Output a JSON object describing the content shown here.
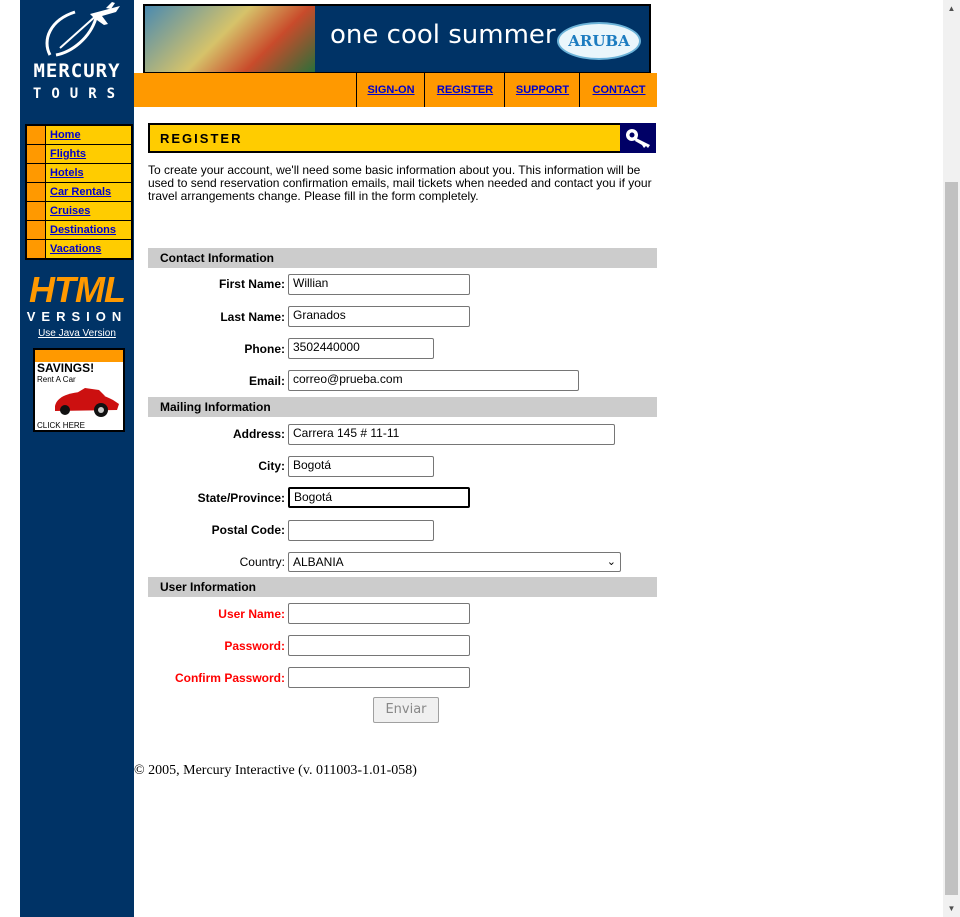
{
  "logo": {
    "line1": "MERCURY",
    "line2": "TOURS"
  },
  "left_nav": {
    "items": [
      "Home",
      "Flights",
      "Hotels",
      "Car Rentals",
      "Cruises",
      "Destinations",
      "Vacations"
    ]
  },
  "html_version": {
    "badge": "HTML",
    "label": "VERSION",
    "java_link": "Use Java Version"
  },
  "ad": {
    "title": "SAVINGS!",
    "subtitle": "Rent A Car",
    "cta": "CLICK HERE"
  },
  "banner": {
    "text": "one cool summer",
    "logo": "ARUBA"
  },
  "top_nav": {
    "items": [
      "SIGN-ON",
      "REGISTER",
      "SUPPORT",
      "CONTACT"
    ]
  },
  "page": {
    "title": "REGISTER",
    "intro": "To create your account, we'll need some basic information about you. This information will be used to send reservation confirmation emails, mail tickets when needed and contact you if your travel arrangements change. Please fill in the form completely."
  },
  "sections": {
    "contact": {
      "header": "Contact Information",
      "first_name": {
        "label": "First Name:",
        "value": "Willian"
      },
      "last_name": {
        "label": "Last Name:",
        "value": "Granados"
      },
      "phone": {
        "label": "Phone:",
        "value": "3502440000"
      },
      "email": {
        "label": "Email:",
        "value": "correo@prueba.com"
      }
    },
    "mailing": {
      "header": "Mailing Information",
      "address": {
        "label": "Address:",
        "value": "Carrera 145 # 11-11"
      },
      "city": {
        "label": "City:",
        "value": "Bogotá"
      },
      "state": {
        "label": "State/Province:",
        "value": "Bogotá"
      },
      "postal": {
        "label": "Postal Code:",
        "value": ""
      },
      "country": {
        "label": "Country:",
        "value": "ALBANIA"
      }
    },
    "user": {
      "header": "User Information",
      "username": {
        "label": "User Name:",
        "value": ""
      },
      "password": {
        "label": "Password:",
        "value": ""
      },
      "confirm": {
        "label": "Confirm Password:",
        "value": ""
      }
    }
  },
  "submit_label": "Enviar",
  "footer": {
    "copyright": "© 2005, Mercury Interactive (v. 011003-1.01-058)"
  },
  "colors": {
    "sidebar": "#003366",
    "accent_orange": "#ff9900",
    "accent_yellow": "#ffcc00",
    "link": "#0000cc",
    "required_red": "#ff0000"
  },
  "icons": [
    "plane-logo-icon",
    "key-icon",
    "chevron-down-icon",
    "scroll-up-icon",
    "scroll-down-icon",
    "car-icon"
  ]
}
